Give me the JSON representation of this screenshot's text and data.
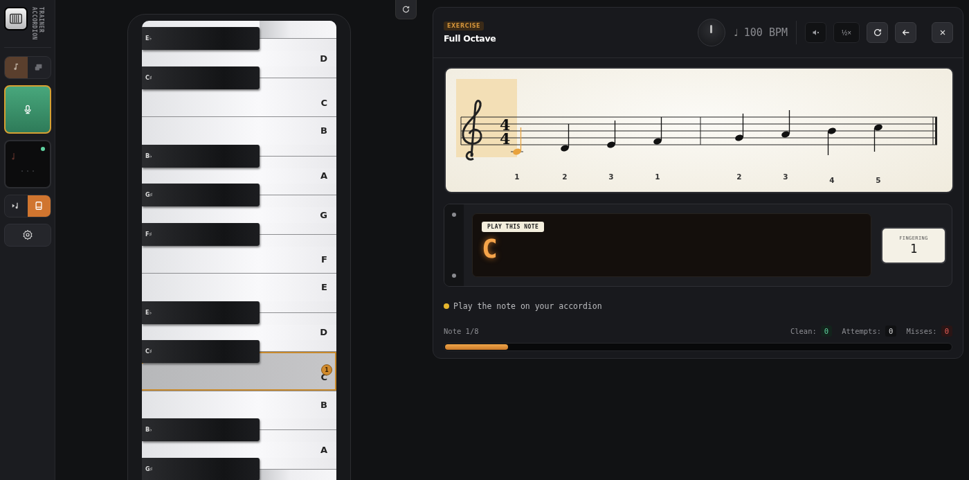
{
  "sidebar": {
    "title": [
      "ACCORDION",
      "TRAINER"
    ],
    "mode_toggle": [
      {
        "kind": "note",
        "selected": true
      },
      {
        "kind": "score",
        "selected": false
      }
    ],
    "mic": {
      "active": true
    },
    "preview": {
      "connected": true
    },
    "view_toggle": [
      {
        "kind": "play",
        "selected": false
      },
      {
        "kind": "book",
        "selected": true
      }
    ]
  },
  "keyboard": {
    "keys": [
      {
        "selected": false
      },
      {
        "label": "D",
        "sharp": "E♭",
        "selected": false
      },
      {
        "label": "C",
        "sharp": "C♯",
        "selected": false
      },
      {
        "label": "B",
        "selected": false
      },
      {
        "label": "A",
        "sharp": "B♭",
        "selected": false
      },
      {
        "label": "G",
        "sharp": "G♯",
        "selected": false
      },
      {
        "label": "F",
        "sharp": "F♯",
        "selected": false
      },
      {
        "label": "E",
        "selected": false
      },
      {
        "label": "D",
        "sharp": "E♭",
        "selected": false
      },
      {
        "label": "C",
        "sharp": "C♯",
        "selected": true,
        "badge": "1"
      },
      {
        "label": "B",
        "selected": false
      },
      {
        "label": "A",
        "sharp": "B♭",
        "selected": false
      },
      {
        "sharp": "G♯",
        "selected": false
      }
    ]
  },
  "exercise": {
    "badge": "EXERCISE",
    "title": "Full Octave",
    "tempo_symbol": "♩",
    "tempo": "100 BPM",
    "buttons": [
      {
        "kind": "mute"
      },
      {
        "kind": "half-speed",
        "label": "½×"
      },
      {
        "kind": "restart"
      },
      {
        "kind": "back"
      },
      {
        "kind": "close"
      }
    ]
  },
  "score": {
    "time_signature": [
      "4",
      "4"
    ],
    "notes": [
      {
        "finger": "1",
        "selected": true
      },
      {
        "finger": "2",
        "selected": false
      },
      {
        "finger": "3",
        "selected": false
      },
      {
        "finger": "1",
        "selected": false
      },
      {
        "finger": "2",
        "selected": false
      },
      {
        "finger": "3",
        "selected": false
      },
      {
        "finger": "4",
        "selected": false
      },
      {
        "finger": "5",
        "selected": false
      }
    ]
  },
  "prompt": {
    "label": "PLAY THIS NOTE",
    "note": "C",
    "fingering_label": "FINGERING",
    "fingering": "1"
  },
  "status": {
    "message": "Play the note on your accordion",
    "note_count": "Note 1/8",
    "stats": [
      {
        "label": "Clean:",
        "value": "0",
        "kind": "good"
      },
      {
        "label": "Attempts:",
        "value": "0",
        "kind": "neutral"
      },
      {
        "label": "Misses:",
        "value": "0",
        "kind": "bad"
      }
    ],
    "level": 0.125
  }
}
